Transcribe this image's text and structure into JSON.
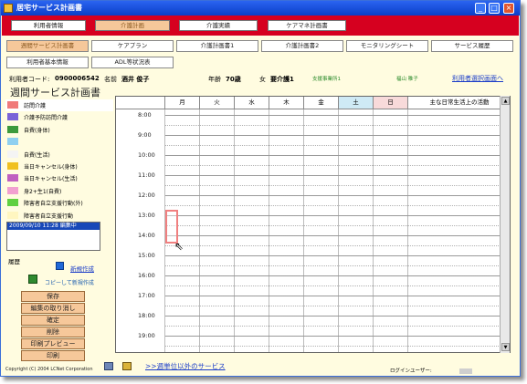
{
  "window": {
    "title": "居宅サービス計画書",
    "minimize": "_",
    "maximize": "□",
    "close": "×"
  },
  "nav": [
    {
      "label": "利用者情報",
      "active": false
    },
    {
      "label": "介護計画",
      "active": true
    },
    {
      "label": "介護実績",
      "active": false
    },
    {
      "label": "ケアマネ計画書",
      "active": false
    }
  ],
  "buttons_row1": [
    {
      "label": "週間サービス計画書",
      "active": true
    },
    {
      "label": "ケアプラン",
      "active": false
    },
    {
      "label": "介護計画書1",
      "active": false
    },
    {
      "label": "介護計画書2",
      "active": false
    },
    {
      "label": "モニタリングシート",
      "active": false
    },
    {
      "label": "サービス履歴",
      "active": false
    }
  ],
  "buttons_row2": [
    {
      "label": "利用者基本情報",
      "active": false
    },
    {
      "label": "ADL等状況表",
      "active": false
    }
  ],
  "info": {
    "user_code_label": "利用者コード:",
    "user_code": "0900006542",
    "name_label": "名前",
    "name": "酒井 俊子",
    "age_label": "年齢",
    "age": "70歳",
    "sex": "女",
    "care_level": "要介護1",
    "support_office": "支援事業所1",
    "staff": "福山 稚子",
    "select_link": "利用者選択画面へ"
  },
  "page_title": "週間サービス計画書",
  "legend": [
    {
      "label": "訪問介護",
      "color": "#f07a7a",
      "selected": true
    },
    {
      "label": "介護予防訪問介護",
      "color": "#7a63d8",
      "selected": false
    },
    {
      "label": "自費(身体)",
      "color": "#3c9a3c",
      "selected": false
    },
    {
      "label": "",
      "color": "#8fd0f0",
      "selected": false
    },
    {
      "label": "自費(生活)",
      "color": "#f4f4f4",
      "selected": false
    },
    {
      "label": "当日キャンセル(身体)",
      "color": "#f0c020",
      "selected": false
    },
    {
      "label": "当日キャンセル(生活)",
      "color": "#c060c0",
      "selected": false
    },
    {
      "label": "身2+生1(自費)",
      "color": "#f2a0d0",
      "selected": false
    },
    {
      "label": "障害者自立支援行動(外)",
      "color": "#60d040",
      "selected": false
    },
    {
      "label": "障害者自立支援行動",
      "color": "#fff6c0",
      "selected": false
    }
  ],
  "history_list": [
    "2009/09/10 11:28 編集中"
  ],
  "history_label": "履歴",
  "history_link": "新規作成",
  "copy_label": "コピーして新規作成",
  "actions": [
    "保存",
    "編集の取り消し",
    "確定",
    "削除",
    "印刷プレビュー",
    "印刷"
  ],
  "grid": {
    "days": [
      "月",
      "火",
      "水",
      "木",
      "金",
      "土",
      "日"
    ],
    "activities_header": "主な日常生活上の活動",
    "times": [
      "8:00",
      "9:00",
      "10:00",
      "11:00",
      "12:00",
      "13:00",
      "14:00",
      "15:00",
      "16:00",
      "17:00",
      "18:00",
      "19:00"
    ]
  },
  "copyright": "Copyright (C) 2004 LCNet Corporation",
  "bottom_link": ">>週単位以外のサービス",
  "login_label": "ログインユーザー:"
}
